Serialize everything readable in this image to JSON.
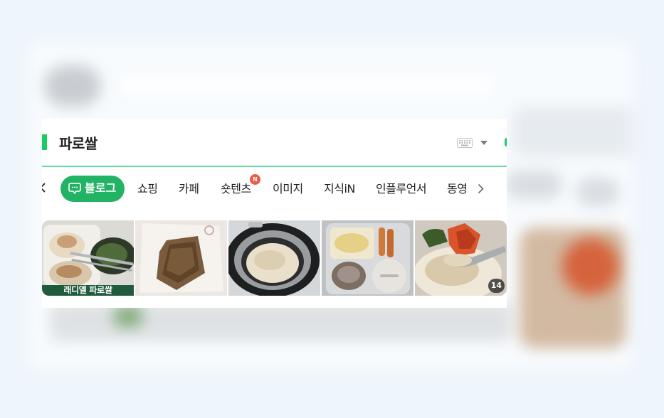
{
  "search": {
    "query": "파로쌀"
  },
  "tabs": {
    "blog": "블로그",
    "items": [
      "쇼핑",
      "카페",
      "숏텐츠",
      "이미지",
      "지식iN",
      "인플루언서",
      "동영"
    ],
    "new_badge": "N"
  },
  "thumbnails": {
    "first_caption": "래디엘 파로쌀",
    "last_count": "14"
  },
  "colors": {
    "accent": "#19ce60",
    "blog_pill": "#23b364",
    "badge": "#f05a44"
  }
}
